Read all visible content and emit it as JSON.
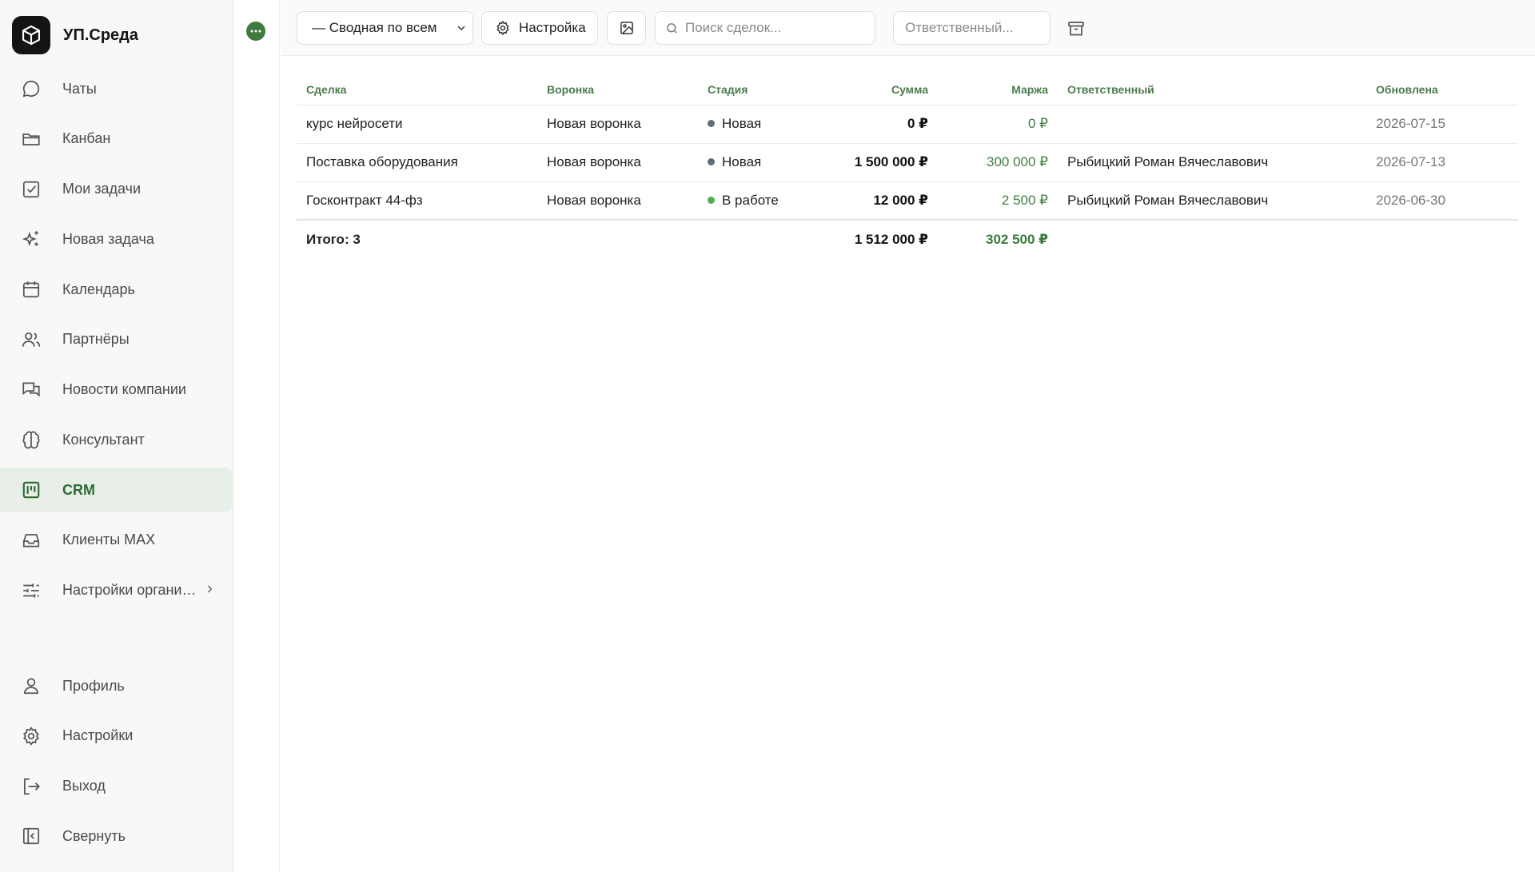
{
  "app": {
    "name": "УП.Среда"
  },
  "sidebar": {
    "items": [
      {
        "id": "chats",
        "label": "Чаты",
        "icon": "chat-bubble-icon"
      },
      {
        "id": "kanban",
        "label": "Канбан",
        "icon": "folder-icon"
      },
      {
        "id": "my-tasks",
        "label": "Мои задачи",
        "icon": "checkbox-icon"
      },
      {
        "id": "new-task",
        "label": "Новая задача",
        "icon": "sparkles-icon"
      },
      {
        "id": "calendar",
        "label": "Календарь",
        "icon": "calendar-icon"
      },
      {
        "id": "partners",
        "label": "Партнёры",
        "icon": "users-icon"
      },
      {
        "id": "company-news",
        "label": "Новости компании",
        "icon": "messages-icon"
      },
      {
        "id": "consultant",
        "label": "Консультант",
        "icon": "brain-icon"
      },
      {
        "id": "crm",
        "label": "CRM",
        "icon": "crm-board-icon",
        "active": true
      },
      {
        "id": "clients-max",
        "label": "Клиенты MAX",
        "icon": "inbox-icon"
      },
      {
        "id": "org-settings",
        "label": "Настройки органи…",
        "icon": "sliders-icon"
      }
    ],
    "bottom": [
      {
        "id": "profile",
        "label": "Профиль",
        "icon": "user-icon"
      },
      {
        "id": "settings",
        "label": "Настройки",
        "icon": "gear-icon"
      },
      {
        "id": "logout",
        "label": "Выход",
        "icon": "logout-icon"
      },
      {
        "id": "collapse",
        "label": "Свернуть",
        "icon": "collapse-panel-icon"
      }
    ]
  },
  "toolbar": {
    "funnel_select": "— Сводная по всем",
    "settings_label": "Настройка",
    "search_placeholder": "Поиск сделок...",
    "owner_placeholder": "Ответственный..."
  },
  "table": {
    "columns": {
      "deal": "Сделка",
      "funnel": "Воронка",
      "stage": "Стадия",
      "sum": "Сумма",
      "margin": "Маржа",
      "owner": "Ответственный",
      "updated": "Обновлена"
    },
    "rows": [
      {
        "deal": "курс нейросети",
        "funnel": "Новая воронка",
        "stage": "Новая",
        "stage_color": "#5f6b76",
        "sum": "0 ₽",
        "margin": "0 ₽",
        "owner": "",
        "updated": "2026-07-15"
      },
      {
        "deal": "Поставка оборудования",
        "funnel": "Новая воронка",
        "stage": "Новая",
        "stage_color": "#5f6b76",
        "sum": "1 500 000 ₽",
        "margin": "300 000 ₽",
        "owner": "Рыбицкий Роман Вячеславович",
        "updated": "2026-07-13"
      },
      {
        "deal": "Госконтракт 44-фз",
        "funnel": "Новая воронка",
        "stage": "В работе",
        "stage_color": "#4caf50",
        "sum": "12 000 ₽",
        "margin": "2 500 ₽",
        "owner": "Рыбицкий Роман Вячеславович",
        "updated": "2026-06-30"
      }
    ],
    "total": {
      "label": "Итого: 3",
      "sum": "1 512 000 ₽",
      "margin": "302 500 ₽"
    }
  },
  "colors": {
    "accent": "#3f7a3f",
    "active_bg": "#e8eee8",
    "header_text": "#4a7d4c"
  }
}
